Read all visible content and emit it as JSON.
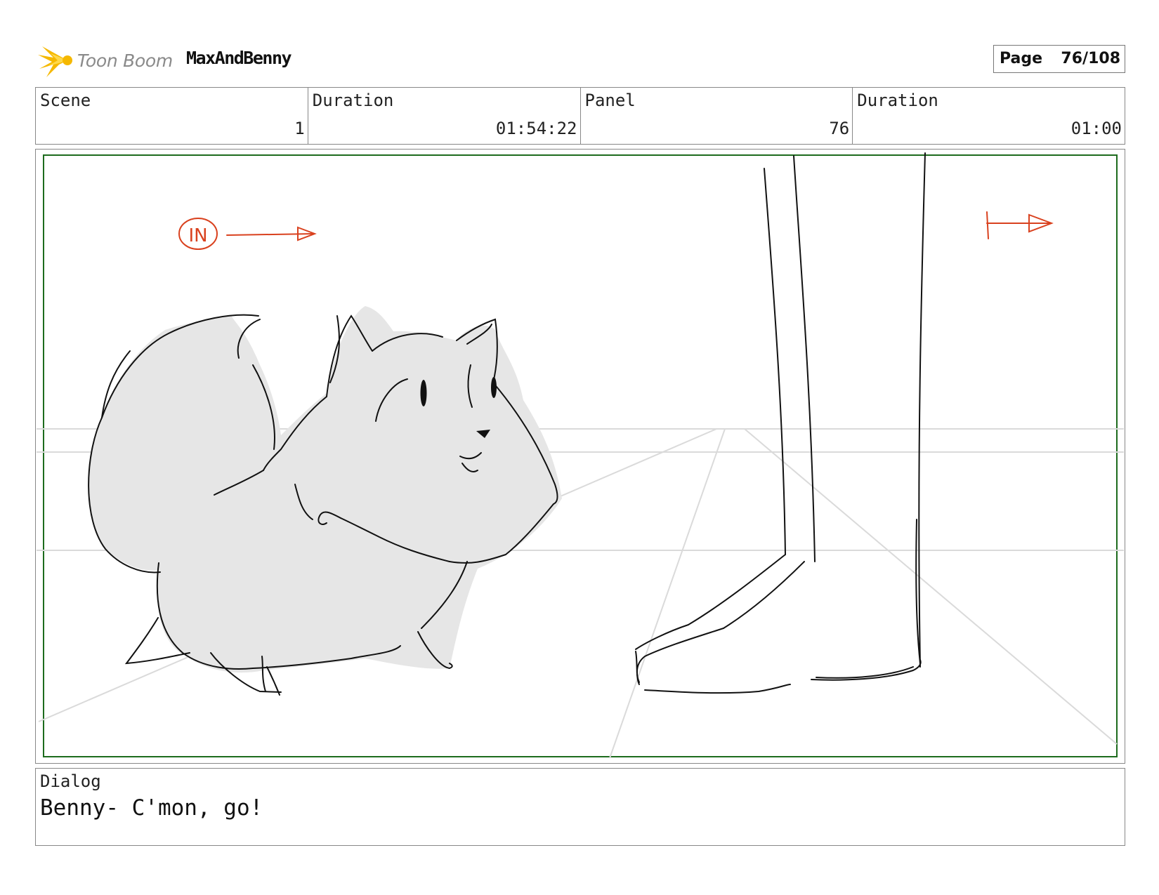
{
  "header": {
    "logo_text": "Toon Boom",
    "project": "MaxAndBenny",
    "page_label": "Page",
    "page_number": "76/108"
  },
  "info": {
    "scene_label": "Scene",
    "scene_value": "1",
    "duration_label": "Duration",
    "duration_value": "01:54:22",
    "panel_label": "Panel",
    "panel_value": "76",
    "panel_duration_label": "Duration",
    "panel_duration_value": "01:00"
  },
  "sketch": {
    "annotation_in": "IN",
    "annotation_color": "#d9411e",
    "frame_color": "#1d6b1d"
  },
  "dialog": {
    "label": "Dialog",
    "text": "Benny- C'mon, go!"
  }
}
